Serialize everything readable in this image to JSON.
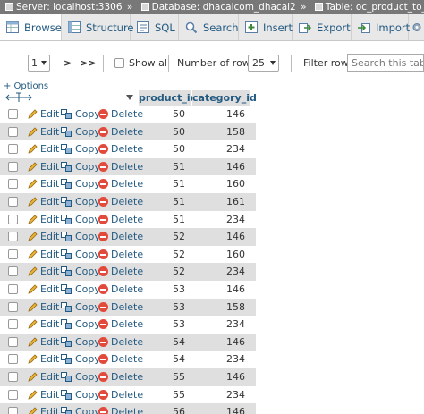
{
  "breadcrumb": {
    "server": "Server: localhost:3306",
    "database": "Database: dhacaicom_dhacai2",
    "table": "Table: oc_product_to_category",
    "separator": "»"
  },
  "tabs": [
    {
      "label": "Browse",
      "icon": "browse-icon",
      "active": true
    },
    {
      "label": "Structure",
      "icon": "structure-icon",
      "active": false
    },
    {
      "label": "SQL",
      "icon": "sql-icon",
      "active": false
    },
    {
      "label": "Search",
      "icon": "search-icon",
      "active": false
    },
    {
      "label": "Insert",
      "icon": "insert-icon",
      "active": false
    },
    {
      "label": "Export",
      "icon": "export-icon",
      "active": false
    },
    {
      "label": "Import",
      "icon": "import-icon",
      "active": false
    }
  ],
  "navigation": {
    "page": "1",
    "next": ">",
    "last": ">>",
    "show_all": "Show all",
    "rows_label": "Number of rows:",
    "rows_value": "25",
    "filter_label": "Filter rows:",
    "filter_placeholder": "Search this table"
  },
  "options_link": "+ Options",
  "columns": [
    "product_id",
    "category_id"
  ],
  "actions": {
    "edit": "Edit",
    "copy": "Copy",
    "delete": "Delete"
  },
  "rows": [
    {
      "product_id": "50",
      "category_id": "146"
    },
    {
      "product_id": "50",
      "category_id": "158"
    },
    {
      "product_id": "50",
      "category_id": "234"
    },
    {
      "product_id": "51",
      "category_id": "146"
    },
    {
      "product_id": "51",
      "category_id": "160"
    },
    {
      "product_id": "51",
      "category_id": "161"
    },
    {
      "product_id": "51",
      "category_id": "234"
    },
    {
      "product_id": "52",
      "category_id": "146"
    },
    {
      "product_id": "52",
      "category_id": "160"
    },
    {
      "product_id": "52",
      "category_id": "234"
    },
    {
      "product_id": "53",
      "category_id": "146"
    },
    {
      "product_id": "53",
      "category_id": "158"
    },
    {
      "product_id": "53",
      "category_id": "234"
    },
    {
      "product_id": "54",
      "category_id": "146"
    },
    {
      "product_id": "54",
      "category_id": "234"
    },
    {
      "product_id": "55",
      "category_id": "146"
    },
    {
      "product_id": "55",
      "category_id": "234"
    },
    {
      "product_id": "56",
      "category_id": "146"
    }
  ],
  "colors": {
    "link": "#235a81",
    "header_bg": "#787878",
    "tabbar_bg": "#e8e8e8",
    "row_alt": "#dfdfdf",
    "delete": "#e24b3b"
  }
}
